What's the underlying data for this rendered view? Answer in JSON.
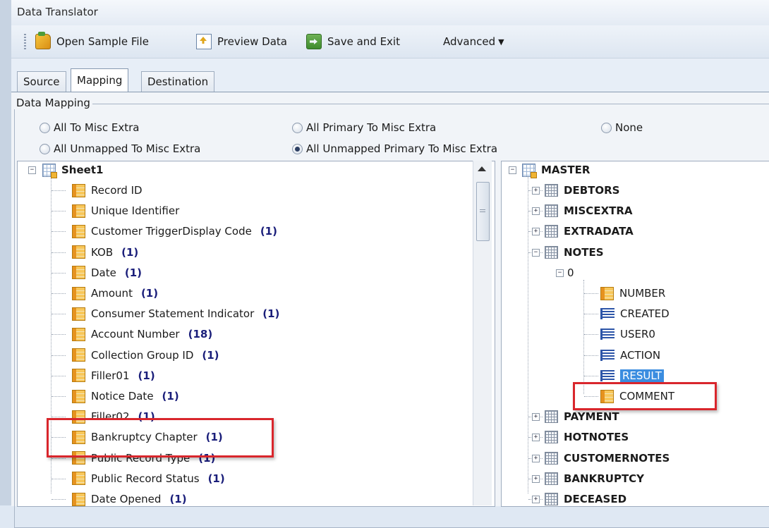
{
  "window": {
    "title": "Data Translator"
  },
  "toolbar": {
    "open_sample_file": "Open Sample File",
    "preview_data": "Preview Data",
    "save_and_exit": "Save and Exit",
    "advanced": "Advanced"
  },
  "tabs": [
    "Source",
    "Mapping",
    "Destination"
  ],
  "mapping": {
    "group_label": "Data Mapping",
    "options": [
      {
        "label": "All To Misc Extra",
        "checked": false
      },
      {
        "label": "All Primary To Misc Extra",
        "checked": false
      },
      {
        "label": "None",
        "checked": false
      },
      {
        "label": "All Unmapped To Misc Extra",
        "checked": false
      },
      {
        "label": "All Unmapped Primary To Misc Extra",
        "checked": true
      }
    ]
  },
  "source_tree": {
    "root": "Sheet1",
    "fields": [
      {
        "name": "Record ID",
        "count": ""
      },
      {
        "name": "Unique Identifier",
        "count": ""
      },
      {
        "name": "Customer TriggerDisplay Code",
        "count": "(1)"
      },
      {
        "name": "KOB",
        "count": "(1)"
      },
      {
        "name": "Date",
        "count": "(1)"
      },
      {
        "name": "Amount",
        "count": "(1)"
      },
      {
        "name": "Consumer Statement Indicator",
        "count": "(1)"
      },
      {
        "name": "Account Number",
        "count": "(18)"
      },
      {
        "name": "Collection Group ID",
        "count": "(1)"
      },
      {
        "name": "Filler01",
        "count": "(1)"
      },
      {
        "name": "Notice Date",
        "count": "(1)"
      },
      {
        "name": "Filler02",
        "count": "(1)"
      },
      {
        "name": "Bankruptcy Chapter",
        "count": "(1)"
      },
      {
        "name": "Public Record Type",
        "count": "(1)"
      },
      {
        "name": "Public Record Status",
        "count": "(1)"
      },
      {
        "name": "Date Opened",
        "count": "(1)"
      }
    ]
  },
  "dest_tree": {
    "root": "MASTER",
    "tables_before": [
      "DEBTORS",
      "MISCEXTRA",
      "EXTRADATA"
    ],
    "expanded_table": "NOTES",
    "index_node": "0",
    "notes_fields": [
      {
        "name": "NUMBER",
        "icon": "field"
      },
      {
        "name": "CREATED",
        "icon": "lines"
      },
      {
        "name": "USER0",
        "icon": "lines"
      },
      {
        "name": "ACTION",
        "icon": "lines"
      },
      {
        "name": "RESULT",
        "icon": "lines",
        "selected": true
      },
      {
        "name": "COMMENT",
        "icon": "field"
      }
    ],
    "tables_after": [
      "PAYMENT",
      "HOTNOTES",
      "CUSTOMERNOTES",
      "BANKRUPTCY",
      "DECEASED"
    ]
  }
}
